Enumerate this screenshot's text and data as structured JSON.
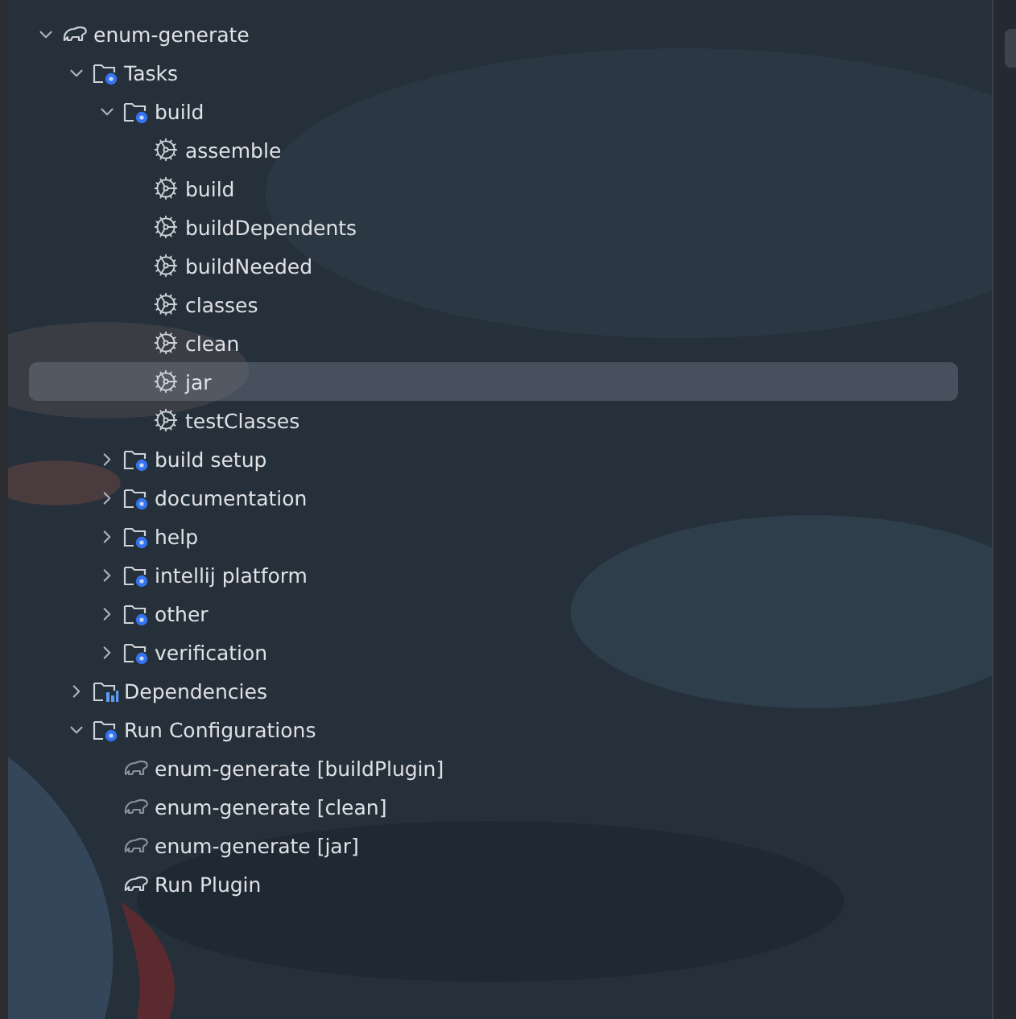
{
  "tree": [
    {
      "label": "enum-generate",
      "kind": "project",
      "expanded": true,
      "selected": false,
      "children": [
        {
          "label": "Tasks",
          "kind": "folder",
          "expanded": true,
          "selected": false,
          "children": [
            {
              "label": "build",
              "kind": "folder",
              "expanded": true,
              "selected": false,
              "children": [
                {
                  "label": "assemble",
                  "kind": "task",
                  "selected": false
                },
                {
                  "label": "build",
                  "kind": "task",
                  "selected": false
                },
                {
                  "label": "buildDependents",
                  "kind": "task",
                  "selected": false
                },
                {
                  "label": "buildNeeded",
                  "kind": "task",
                  "selected": false
                },
                {
                  "label": "classes",
                  "kind": "task",
                  "selected": false
                },
                {
                  "label": "clean",
                  "kind": "task",
                  "selected": false
                },
                {
                  "label": "jar",
                  "kind": "task",
                  "selected": true
                },
                {
                  "label": "testClasses",
                  "kind": "task",
                  "selected": false
                }
              ]
            },
            {
              "label": "build setup",
              "kind": "folder",
              "expanded": false,
              "selected": false
            },
            {
              "label": "documentation",
              "kind": "folder",
              "expanded": false,
              "selected": false
            },
            {
              "label": "help",
              "kind": "folder",
              "expanded": false,
              "selected": false
            },
            {
              "label": "intellij platform",
              "kind": "folder",
              "expanded": false,
              "selected": false
            },
            {
              "label": "other",
              "kind": "folder",
              "expanded": false,
              "selected": false
            },
            {
              "label": "verification",
              "kind": "folder",
              "expanded": false,
              "selected": false
            }
          ]
        },
        {
          "label": "Dependencies",
          "kind": "dependencies",
          "expanded": false,
          "selected": false
        },
        {
          "label": "Run Configurations",
          "kind": "folder",
          "expanded": true,
          "selected": false,
          "children": [
            {
              "label": "enum-generate [buildPlugin]",
              "kind": "temp_config",
              "selected": false
            },
            {
              "label": "enum-generate [clean]",
              "kind": "temp_config",
              "selected": false
            },
            {
              "label": "enum-generate [jar]",
              "kind": "temp_config",
              "selected": false
            },
            {
              "label": "Run Plugin",
              "kind": "config",
              "selected": false
            }
          ]
        }
      ]
    }
  ]
}
